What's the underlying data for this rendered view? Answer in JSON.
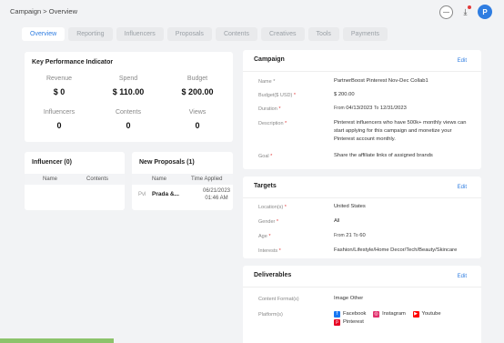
{
  "breadcrumb": {
    "parent": "Campaign",
    "separator": ">",
    "current": "Overview"
  },
  "header_icons": {
    "minus": "minus-circle-icon",
    "download": "download-icon",
    "avatar_letter": "P"
  },
  "tabs": [
    {
      "label": "Overview",
      "active": true
    },
    {
      "label": "Reporting"
    },
    {
      "label": "Influencers"
    },
    {
      "label": "Proposals"
    },
    {
      "label": "Contents"
    },
    {
      "label": "Creatives"
    },
    {
      "label": "Tools"
    },
    {
      "label": "Payments"
    }
  ],
  "kpi": {
    "title": "Key Performance Indicator",
    "cells": [
      {
        "label": "Revenue",
        "value": "$ 0"
      },
      {
        "label": "Spend",
        "value": "$ 110.00"
      },
      {
        "label": "Budget",
        "value": "$ 200.00"
      },
      {
        "label": "Influencers",
        "value": "0"
      },
      {
        "label": "Contents",
        "value": "0"
      },
      {
        "label": "Views",
        "value": "0"
      }
    ]
  },
  "influencer": {
    "title": "Influencer (0)",
    "col_name": "Name",
    "col_contents": "Contents"
  },
  "proposals": {
    "title": "New Proposals (1)",
    "col_name": "Name",
    "col_time": "Time Applied",
    "row": {
      "icon": "Pvl",
      "name": "Prada &...",
      "date": "06/21/2023",
      "time": "01:46 AM"
    }
  },
  "campaign": {
    "title": "Campaign",
    "edit": "Edit",
    "name_label": "Name *",
    "name_value": "PartnerBoost Pinterest Nov-Dec Collab1",
    "budget_label": "Budget($ USD)",
    "budget_value": "$ 200.00",
    "duration_label": "Duration",
    "duration_from": "From",
    "duration_start": "04/13/2023",
    "duration_to": "To",
    "duration_end": "12/31/2023",
    "desc_label": "Description",
    "desc_value": "Pinterest influencers who have 500k+ monthly views can start applying for this campaign and monetize your Pinterest account monthly.",
    "goal_label": "Goal",
    "goal_value": "Share the affiliate links of assigned brands"
  },
  "targets": {
    "title": "Targets",
    "edit": "Edit",
    "location_label": "Location(s)",
    "location_value": "United States",
    "gender_label": "Gender",
    "gender_value": "All",
    "age_label": "Age",
    "age_from": "From",
    "age_min": "21",
    "age_to": "To",
    "age_max": "60",
    "interests_label": "Interests",
    "interests_value": "Fashion/Lifestyle/Home Decor/Tech/Beauty/Skincare"
  },
  "deliverables": {
    "title": "Deliverables",
    "edit": "Edit",
    "format_label": "Content Format(s)",
    "format_value": "Image  Other",
    "platform_label": "Platform(s)",
    "platforms": [
      {
        "name": "Facebook",
        "color": "#1877f2",
        "icon": "facebook-icon"
      },
      {
        "name": "Instagram",
        "color": "#e1306c",
        "icon": "instagram-icon"
      },
      {
        "name": "Youtube",
        "color": "#ff0000",
        "icon": "youtube-icon"
      },
      {
        "name": "Pinterest",
        "color": "#e60023",
        "icon": "pinterest-icon"
      }
    ]
  },
  "colors": {
    "accent": "#2f7de1",
    "required": "#e23b3b",
    "progress": "#8cc36b"
  }
}
